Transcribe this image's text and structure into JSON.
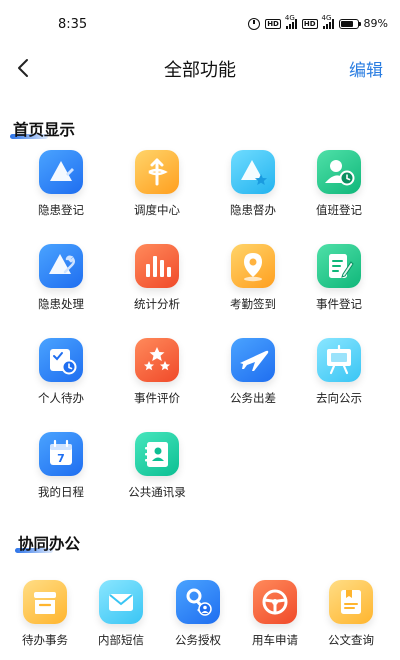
{
  "status_bar": {
    "time": "8:35",
    "hd1": "HD",
    "net1": "4G",
    "hd2": "HD",
    "net2": "4G",
    "battery": "89%"
  },
  "nav": {
    "title": "全部功能",
    "edit_label": "编辑"
  },
  "sections": {
    "home": {
      "title": "首页显示",
      "items": [
        {
          "label": "隐患登记",
          "icon": "triangle-edit-icon",
          "color": "#1f6ef0"
        },
        {
          "label": "调度中心",
          "icon": "dispatch-icon",
          "color": "#ff9f1f"
        },
        {
          "label": "隐患督办",
          "icon": "triangle-star-icon",
          "color": "#23b3ef"
        },
        {
          "label": "值班登记",
          "icon": "user-clock-icon",
          "color": "#10b77a"
        },
        {
          "label": "隐患处理",
          "icon": "triangle-wrench-icon",
          "color": "#1f6ef0"
        },
        {
          "label": "统计分析",
          "icon": "bar-chart-icon",
          "color": "#f04a2a"
        },
        {
          "label": "考勤签到",
          "icon": "location-pin-icon",
          "color": "#ff9f1f"
        },
        {
          "label": "事件登记",
          "icon": "doc-edit-icon",
          "color": "#10b77a"
        },
        {
          "label": "个人待办",
          "icon": "calendar-clock-icon",
          "color": "#1f6ef0"
        },
        {
          "label": "事件评价",
          "icon": "stars-icon",
          "color": "#f04a2a"
        },
        {
          "label": "公务出差",
          "icon": "airplane-icon",
          "color": "#1f6ef0"
        },
        {
          "label": "去向公示",
          "icon": "easel-board-icon",
          "color": "#39c5f4"
        },
        {
          "label": "我的日程",
          "icon": "calendar-7-icon",
          "color": "#1f6ef0"
        },
        {
          "label": "公共通讯录",
          "icon": "contact-book-icon",
          "color": "#0cbf93"
        }
      ]
    },
    "collab": {
      "title": "协同办公",
      "items": [
        {
          "label": "待办事务",
          "icon": "inbox-tray-icon",
          "color": "#ffb52e"
        },
        {
          "label": "内部短信",
          "icon": "mail-icon",
          "color": "#39c5f4"
        },
        {
          "label": "公务授权",
          "icon": "key-user-icon",
          "color": "#1f6ef0"
        },
        {
          "label": "用车申请",
          "icon": "steering-wheel-icon",
          "color": "#f04a2a"
        },
        {
          "label": "公文查询",
          "icon": "document-bookmark-icon",
          "color": "#ffb52e"
        }
      ]
    }
  }
}
